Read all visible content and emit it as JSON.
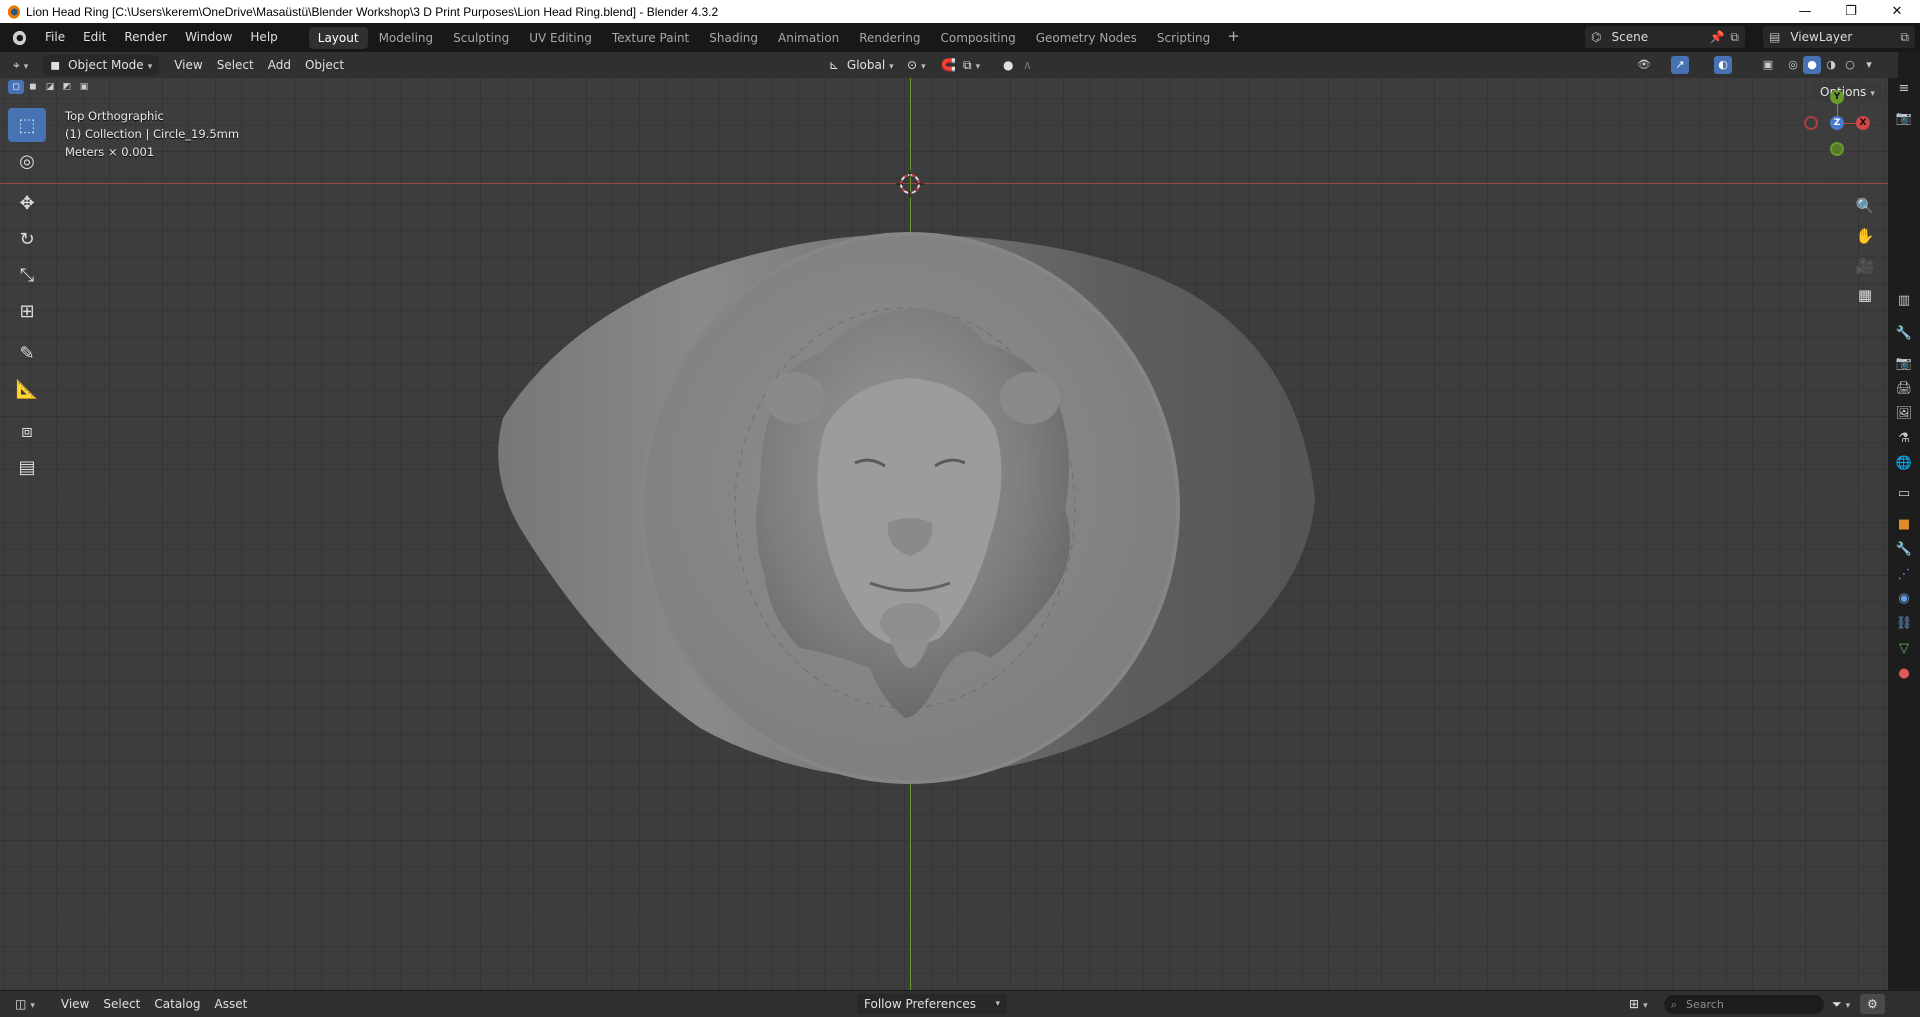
{
  "window": {
    "title": "Lion Head Ring [C:\\Users\\kerem\\OneDrive\\Masaüstü\\Blender Workshop\\3 D Print Purposes\\Lion Head Ring.blend] - Blender 4.3.2",
    "minimize": "—",
    "restore": "❐",
    "close": "✕"
  },
  "menu": {
    "items": [
      "File",
      "Edit",
      "Render",
      "Window",
      "Help"
    ]
  },
  "workspaces": {
    "tabs": [
      "Layout",
      "Modeling",
      "Sculpting",
      "UV Editing",
      "Texture Paint",
      "Shading",
      "Animation",
      "Rendering",
      "Compositing",
      "Geometry Nodes",
      "Scripting"
    ],
    "active": "Layout",
    "add": "+"
  },
  "scene": {
    "name": "Scene",
    "view_layer": "ViewLayer"
  },
  "viewport_header": {
    "mode": "Object Mode",
    "menus": [
      "View",
      "Select",
      "Add",
      "Object"
    ],
    "orientation": "Global"
  },
  "overlay": {
    "view_name": "Top Orthographic",
    "collection": "(1) Collection | Circle_19.5mm",
    "units": "Meters × 0.001",
    "options": "Options"
  },
  "gizmo": {
    "y": "Y",
    "z": "Z",
    "x": "X"
  },
  "bottom": {
    "menus": [
      "View",
      "Select",
      "Catalog",
      "Asset"
    ],
    "follow": "Follow Preferences",
    "search_placeholder": "Search"
  },
  "colors": {
    "accent": "#4772b3",
    "axis_x": "#a04545",
    "axis_y": "#6a9a2b"
  }
}
